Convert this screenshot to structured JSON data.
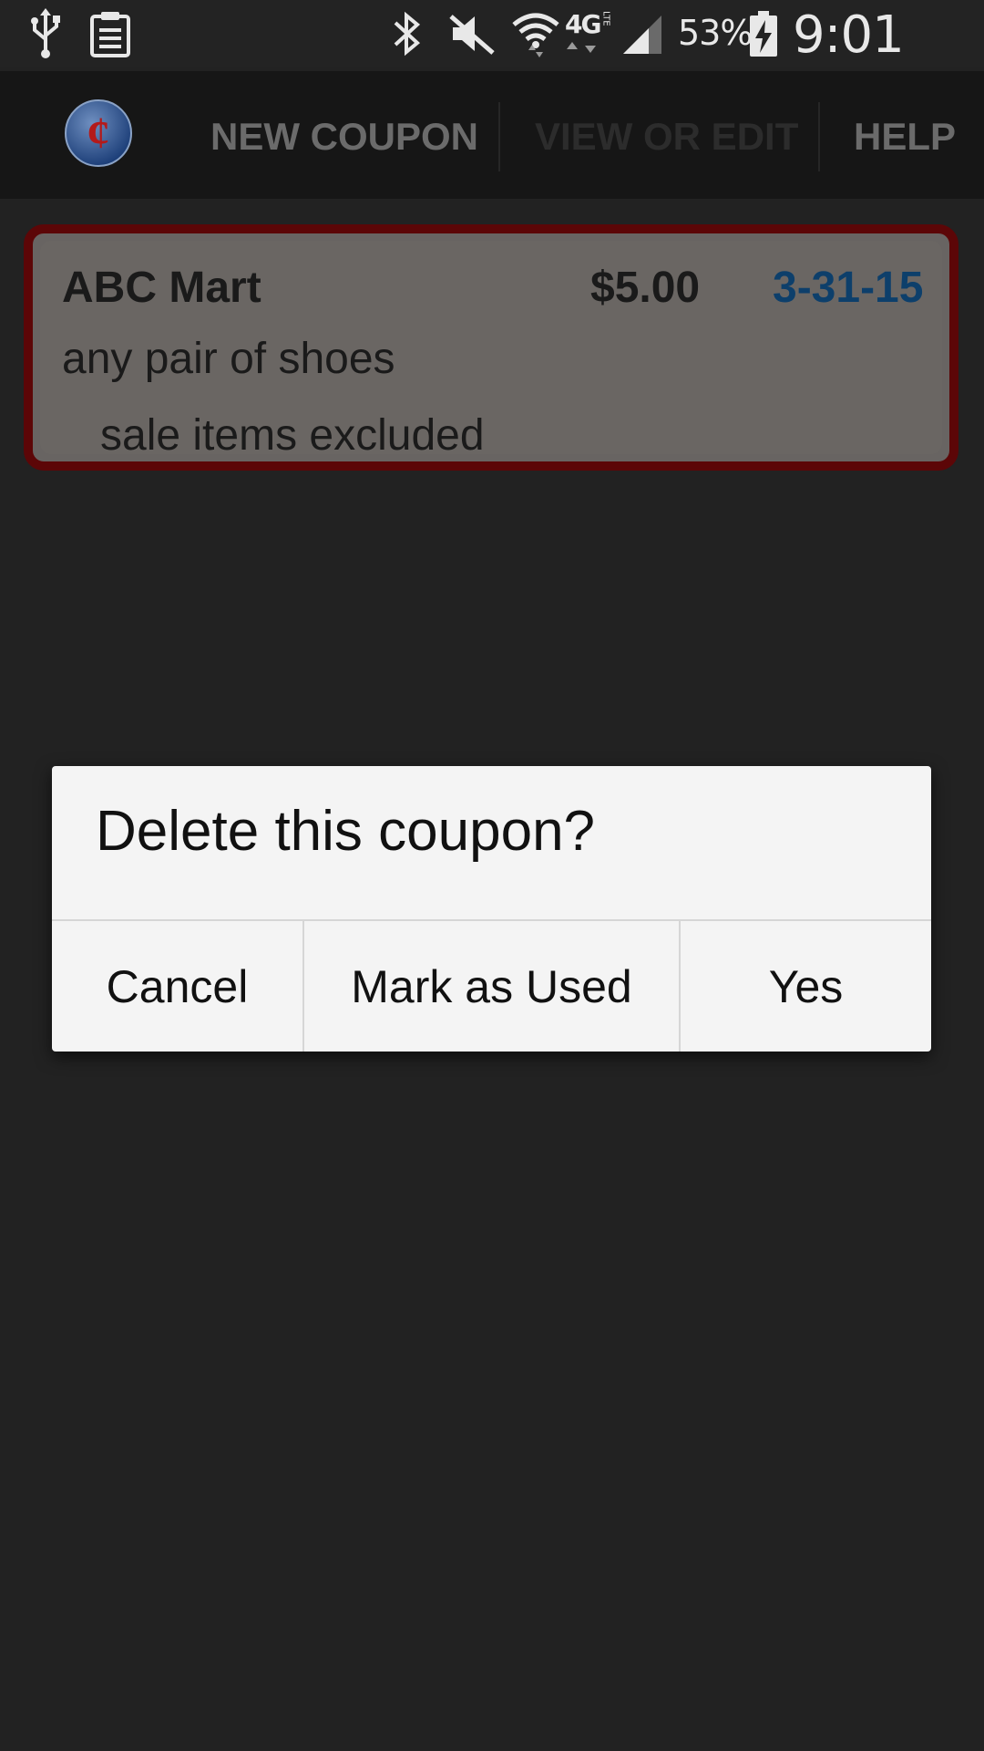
{
  "status_bar": {
    "icons": [
      "usb-icon",
      "clipboard-icon",
      "bluetooth-icon",
      "vibrate-mute-icon",
      "wifi-icon",
      "lte-4g-icon",
      "signal-icon",
      "battery-charging-icon"
    ],
    "network_label": "4G",
    "network_sub_label": "LTE",
    "battery_percent": "53%",
    "time": "9:01 PM"
  },
  "action_bar": {
    "logo_symbol": "¢",
    "tabs": [
      {
        "label": "NEW COUPON"
      },
      {
        "label": "VIEW OR EDIT"
      },
      {
        "label": "HELP"
      }
    ]
  },
  "coupon": {
    "store": "ABC Mart",
    "amount": "$5.00",
    "expiry": "3-31-15",
    "description": "any pair of shoes",
    "note": "sale items excluded"
  },
  "dialog": {
    "title": "Delete this coupon?",
    "buttons": {
      "cancel": "Cancel",
      "mark_used": "Mark as Used",
      "yes": "Yes"
    }
  },
  "colors": {
    "background": "#222222",
    "card_border": "#5c0607",
    "card_fill": "#686462",
    "date_text": "#0d3f6b",
    "dialog_bg": "#f4f4f4"
  }
}
